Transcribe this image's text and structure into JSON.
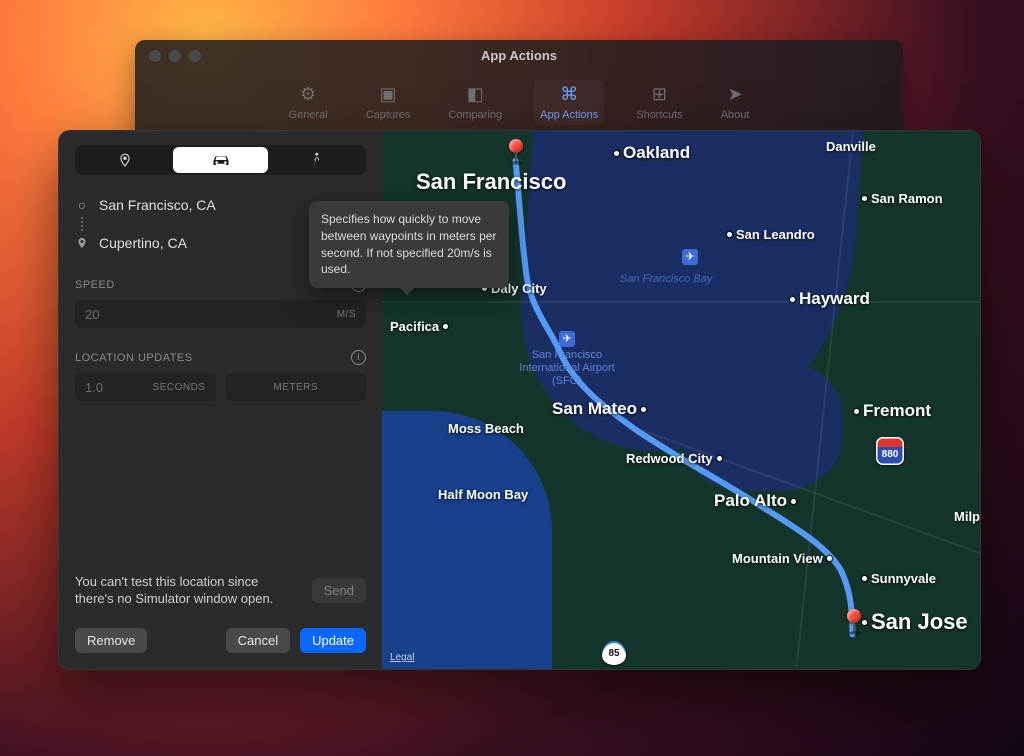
{
  "back_window": {
    "title": "App Actions",
    "tabs": [
      "General",
      "Captures",
      "Comparing",
      "App Actions",
      "Shortcuts",
      "About"
    ],
    "active_tab_index": 3
  },
  "sidebar": {
    "modes": {
      "location_icon": "location-pin-icon",
      "drive_icon": "car-icon",
      "walk_icon": "walk-icon",
      "active_index": 1
    },
    "waypoints": {
      "origin": "San Francisco, CA",
      "destination": "Cupertino, CA"
    },
    "speed": {
      "label": "SPEED",
      "placeholder": "20",
      "unit": "M/S",
      "tooltip": "Specifies how quickly to move between waypoints in meters per second. If not specified 20m/s is used."
    },
    "updates": {
      "label": "LOCATION UPDATES",
      "seconds_placeholder": "1.0",
      "seconds_unit": "SECONDS",
      "meters_unit": "METERS"
    },
    "note": "You can't test this location since there's no Simulator window open.",
    "buttons": {
      "send": "Send",
      "remove": "Remove",
      "cancel": "Cancel",
      "update": "Update"
    }
  },
  "map": {
    "water_label": "San Francisco Bay",
    "airport": "San Francisco International Airport (SFO)",
    "airport_short": "✈",
    "oak_airport_short": "✈",
    "shield_880": "880",
    "shield_85": "85",
    "legal": "Legal",
    "cities": {
      "san_francisco": "San Francisco",
      "oakland": "Oakland",
      "danville": "Danville",
      "san_ramon": "San Ramon",
      "san_leandro": "San Leandro",
      "hayward": "Hayward",
      "daly_city": "Daly City",
      "pacifica": "Pacifica",
      "san_mateo": "San Mateo",
      "moss_beach": "Moss Beach",
      "redwood_city": "Redwood City",
      "half_moon_bay": "Half Moon Bay",
      "palo_alto": "Palo Alto",
      "fremont": "Fremont",
      "mountain_view": "Mountain View",
      "sunnyvale": "Sunnyvale",
      "san_jose": "San Jose",
      "milp": "Milp"
    }
  }
}
